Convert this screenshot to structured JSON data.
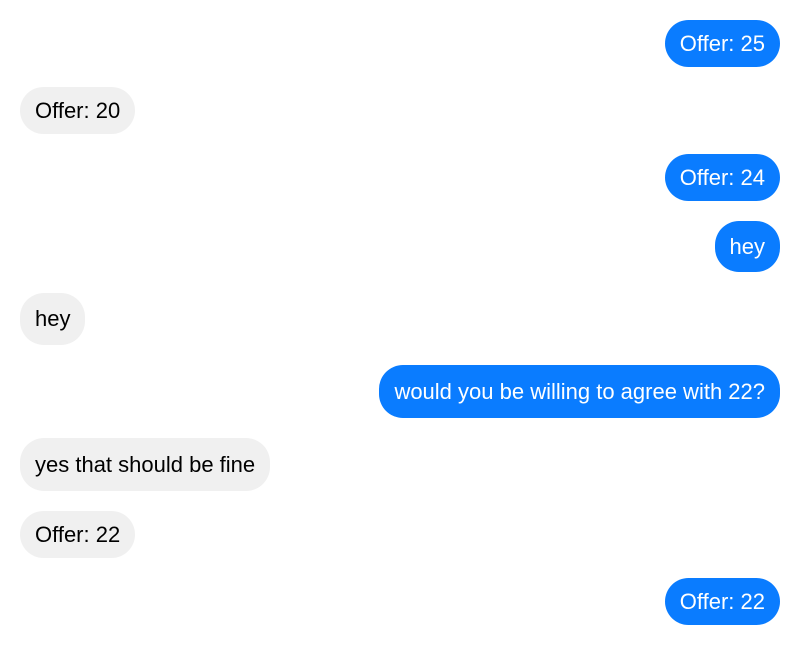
{
  "colors": {
    "sent_bubble": "#0a7cff",
    "received_bubble": "#f0f0f0",
    "sent_text": "#ffffff",
    "received_text": "#000000"
  },
  "messages": [
    {
      "sender": "me",
      "text": "Offer: 25"
    },
    {
      "sender": "them",
      "text": "Offer: 20"
    },
    {
      "sender": "me",
      "text": "Offer: 24"
    },
    {
      "sender": "me",
      "text": "hey"
    },
    {
      "sender": "them",
      "text": "hey"
    },
    {
      "sender": "me",
      "text": "would you be willing to agree with 22?"
    },
    {
      "sender": "them",
      "text": "yes that should be fine"
    },
    {
      "sender": "them",
      "text": "Offer: 22"
    },
    {
      "sender": "me",
      "text": "Offer: 22"
    }
  ]
}
